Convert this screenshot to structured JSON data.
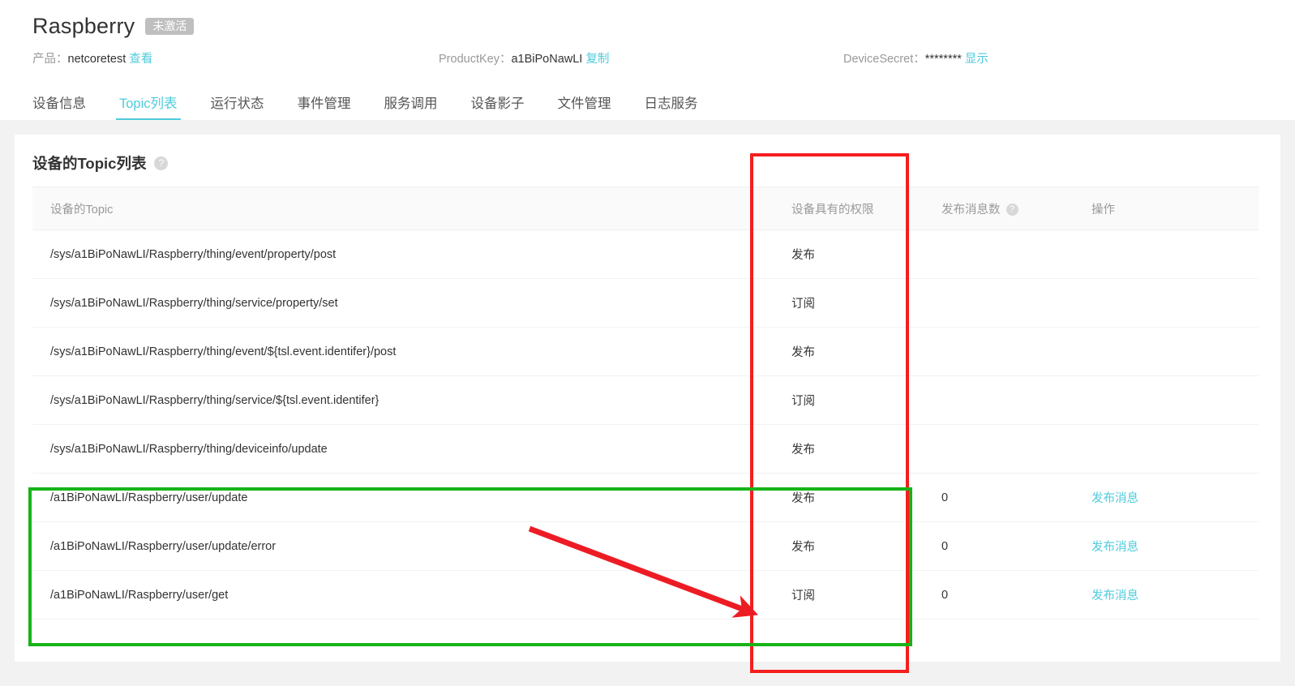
{
  "header": {
    "device_name": "Raspberry",
    "status_badge": "未激活",
    "product_label": "产品：",
    "product_value": "netcoretest",
    "product_view_link": "查看",
    "productkey_label": "ProductKey：",
    "productkey_value": "a1BiPoNawLI",
    "productkey_copy_link": "复制",
    "devicesecret_label": "DeviceSecret：",
    "devicesecret_value": "********",
    "devicesecret_show_link": "显示"
  },
  "tabs": [
    {
      "label": "设备信息",
      "active": false
    },
    {
      "label": "Topic列表",
      "active": true
    },
    {
      "label": "运行状态",
      "active": false
    },
    {
      "label": "事件管理",
      "active": false
    },
    {
      "label": "服务调用",
      "active": false
    },
    {
      "label": "设备影子",
      "active": false
    },
    {
      "label": "文件管理",
      "active": false
    },
    {
      "label": "日志服务",
      "active": false
    }
  ],
  "card": {
    "title": "设备的Topic列表",
    "title_help_icon": "?",
    "columns": {
      "topic": "设备的Topic",
      "permission": "设备具有的权限",
      "publish_count": "发布消息数",
      "publish_count_help_icon": "?",
      "action": "操作"
    },
    "rows": [
      {
        "topic": "/sys/a1BiPoNawLI/Raspberry/thing/event/property/post",
        "permission": "发布",
        "count": "",
        "action": ""
      },
      {
        "topic": "/sys/a1BiPoNawLI/Raspberry/thing/service/property/set",
        "permission": "订阅",
        "count": "",
        "action": ""
      },
      {
        "topic": "/sys/a1BiPoNawLI/Raspberry/thing/event/${tsl.event.identifer}/post",
        "permission": "发布",
        "count": "",
        "action": ""
      },
      {
        "topic": "/sys/a1BiPoNawLI/Raspberry/thing/service/${tsl.event.identifer}",
        "permission": "订阅",
        "count": "",
        "action": ""
      },
      {
        "topic": "/sys/a1BiPoNawLI/Raspberry/thing/deviceinfo/update",
        "permission": "发布",
        "count": "",
        "action": ""
      },
      {
        "topic": "/a1BiPoNawLI/Raspberry/user/update",
        "permission": "发布",
        "count": "0",
        "action": "发布消息"
      },
      {
        "topic": "/a1BiPoNawLI/Raspberry/user/update/error",
        "permission": "发布",
        "count": "0",
        "action": "发布消息"
      },
      {
        "topic": "/a1BiPoNawLI/Raspberry/user/get",
        "permission": "订阅",
        "count": "0",
        "action": "发布消息"
      }
    ]
  },
  "annotations": {
    "red_box_color": "#f41e1e",
    "green_box_color": "#17b318",
    "arrow_color": "#ed1c24"
  },
  "colors": {
    "accent": "#4ecbdc",
    "page_background": "#f2f2f2",
    "card_background": "#ffffff",
    "badge_background": "#bfbfbf"
  }
}
